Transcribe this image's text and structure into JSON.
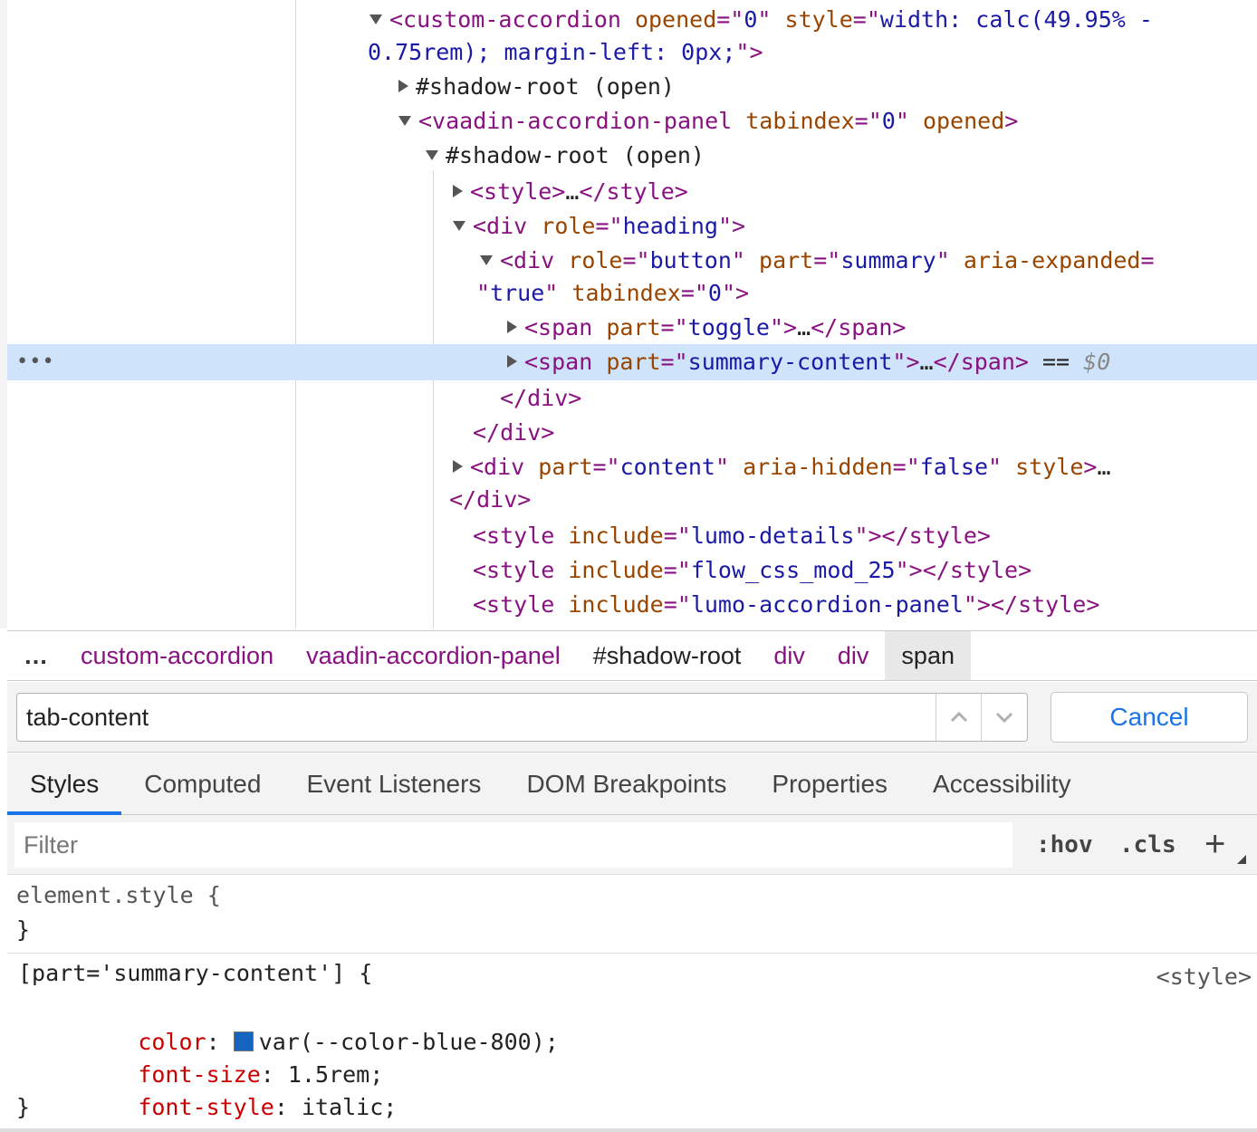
{
  "dom_tree": {
    "lines": [
      {
        "indent": 408,
        "arrow": "down",
        "parts": [
          [
            "tg",
            "<custom-accordion "
          ],
          [
            "an",
            "opened"
          ],
          [
            "tg",
            "=\""
          ],
          [
            "av",
            "0"
          ],
          [
            "tg",
            "\" "
          ],
          [
            "an",
            "style"
          ],
          [
            "tg",
            "=\""
          ],
          [
            "av",
            "width: calc(49.95% -"
          ]
        ]
      },
      {
        "indent": 406,
        "arrow": "",
        "parts": [
          [
            "av",
            "0.75rem); margin-left: 0px;"
          ],
          [
            "tg",
            "\">"
          ]
        ]
      },
      {
        "indent": 440,
        "arrow": "right",
        "parts": [
          [
            "tx",
            "#shadow-root (open)"
          ]
        ]
      },
      {
        "indent": 440,
        "arrow": "down",
        "parts": [
          [
            "tg",
            "<vaadin-accordion-panel "
          ],
          [
            "an",
            "tabindex"
          ],
          [
            "tg",
            "=\""
          ],
          [
            "av",
            "0"
          ],
          [
            "tg",
            "\" "
          ],
          [
            "an",
            "opened"
          ],
          [
            "tg",
            ">"
          ]
        ]
      },
      {
        "indent": 470,
        "arrow": "down",
        "parts": [
          [
            "tx",
            "#shadow-root (open)"
          ]
        ]
      },
      {
        "indent": 500,
        "arrow": "right",
        "parts": [
          [
            "tg",
            "<style>"
          ],
          [
            "tx",
            "…"
          ],
          [
            "tg",
            "</style>"
          ]
        ]
      },
      {
        "indent": 500,
        "arrow": "down",
        "parts": [
          [
            "tg",
            "<div "
          ],
          [
            "an",
            "role"
          ],
          [
            "tg",
            "=\""
          ],
          [
            "av",
            "heading"
          ],
          [
            "tg",
            "\">"
          ]
        ]
      },
      {
        "indent": 530,
        "arrow": "down",
        "parts": [
          [
            "tg",
            "<div "
          ],
          [
            "an",
            "role"
          ],
          [
            "tg",
            "=\""
          ],
          [
            "av",
            "button"
          ],
          [
            "tg",
            "\" "
          ],
          [
            "an",
            "part"
          ],
          [
            "tg",
            "=\""
          ],
          [
            "av",
            "summary"
          ],
          [
            "tg",
            "\" "
          ],
          [
            "an",
            "aria-expanded"
          ],
          [
            "tg",
            "="
          ]
        ]
      },
      {
        "indent": 526,
        "arrow": "",
        "parts": [
          [
            "tg",
            "\""
          ],
          [
            "av",
            "true"
          ],
          [
            "tg",
            "\" "
          ],
          [
            "an",
            "tabindex"
          ],
          [
            "tg",
            "=\""
          ],
          [
            "av",
            "0"
          ],
          [
            "tg",
            "\">"
          ]
        ]
      },
      {
        "indent": 560,
        "arrow": "right",
        "parts": [
          [
            "tg",
            "<span "
          ],
          [
            "an",
            "part"
          ],
          [
            "tg",
            "=\""
          ],
          [
            "av",
            "toggle"
          ],
          [
            "tg",
            "\">"
          ],
          [
            "tx",
            "…"
          ],
          [
            "tg",
            "</span>"
          ]
        ]
      },
      {
        "indent": 560,
        "arrow": "right",
        "selected": true,
        "parts": [
          [
            "tg",
            "<span "
          ],
          [
            "an",
            "part"
          ],
          [
            "tg",
            "=\""
          ],
          [
            "av",
            "summary-content"
          ],
          [
            "tg",
            "\">"
          ],
          [
            "tx",
            "…"
          ],
          [
            "tg",
            "</span>"
          ],
          [
            "tx",
            " == "
          ],
          [
            "dim",
            "$0"
          ]
        ]
      },
      {
        "indent": 552,
        "arrow": "",
        "parts": [
          [
            "tg",
            "</div>"
          ]
        ]
      },
      {
        "indent": 522,
        "arrow": "",
        "parts": [
          [
            "tg",
            "</div>"
          ]
        ]
      },
      {
        "indent": 500,
        "arrow": "right",
        "parts": [
          [
            "tg",
            "<div "
          ],
          [
            "an",
            "part"
          ],
          [
            "tg",
            "=\""
          ],
          [
            "av",
            "content"
          ],
          [
            "tg",
            "\" "
          ],
          [
            "an",
            "aria-hidden"
          ],
          [
            "tg",
            "=\""
          ],
          [
            "av",
            "false"
          ],
          [
            "tg",
            "\" "
          ],
          [
            "an",
            "style"
          ],
          [
            "tg",
            ">"
          ],
          [
            "tx",
            "…"
          ]
        ]
      },
      {
        "indent": 496,
        "arrow": "",
        "parts": [
          [
            "tg",
            "</div>"
          ]
        ]
      },
      {
        "indent": 522,
        "arrow": "",
        "parts": [
          [
            "tg",
            "<style "
          ],
          [
            "an",
            "include"
          ],
          [
            "tg",
            "=\""
          ],
          [
            "av",
            "lumo-details"
          ],
          [
            "tg",
            "\"></style>"
          ]
        ]
      },
      {
        "indent": 522,
        "arrow": "",
        "parts": [
          [
            "tg",
            "<style "
          ],
          [
            "an",
            "include"
          ],
          [
            "tg",
            "=\""
          ],
          [
            "av",
            "flow_css_mod_25"
          ],
          [
            "tg",
            "\"></style>"
          ]
        ]
      },
      {
        "indent": 522,
        "arrow": "",
        "parts": [
          [
            "tg",
            "<style "
          ],
          [
            "an",
            "include"
          ],
          [
            "tg",
            "=\""
          ],
          [
            "av",
            "lumo-accordion-panel"
          ],
          [
            "tg",
            "\"></style>"
          ]
        ]
      }
    ],
    "selected_dots": "•••"
  },
  "breadcrumb": {
    "ellipsis": "…",
    "items": [
      "custom-accordion",
      "vaadin-accordion-panel",
      "#shadow-root",
      "div",
      "div",
      "span"
    ]
  },
  "search": {
    "value": "tab-content",
    "cancel_label": "Cancel"
  },
  "tabs": [
    "Styles",
    "Computed",
    "Event Listeners",
    "DOM Breakpoints",
    "Properties",
    "Accessibility"
  ],
  "active_tab": "Styles",
  "filter": {
    "placeholder": "Filter",
    "hov": ":hov",
    "cls": ".cls",
    "add": "+"
  },
  "rules": {
    "element_style": {
      "selector": "element.style {",
      "close": "}"
    },
    "summary_rule": {
      "selector": "[part='summary-content'] {",
      "source": "<style>",
      "close": "}",
      "declarations": [
        {
          "prop": "color",
          "value": "var(--color-blue-800);",
          "swatch": "#1565c0"
        },
        {
          "prop": "font-size",
          "value": "1.5rem;"
        },
        {
          "prop": "font-style",
          "value": "italic;"
        }
      ]
    }
  }
}
